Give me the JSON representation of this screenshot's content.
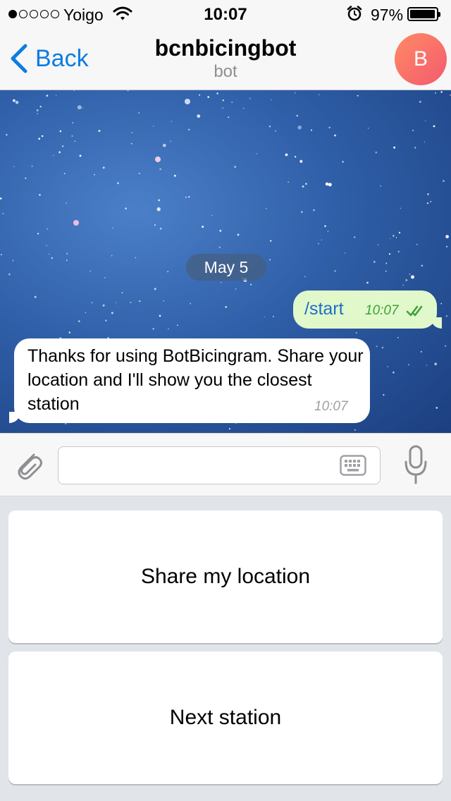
{
  "status_bar": {
    "carrier": "Yoigo",
    "time": "10:07",
    "battery": "97%",
    "battery_level": 0.97,
    "signal_bars_filled": 1,
    "signal_bars_total": 5
  },
  "nav": {
    "back_label": "Back",
    "title": "bcnbicingbot",
    "subtitle": "bot",
    "avatar_initial": "B"
  },
  "chat": {
    "date_label": "May 5",
    "messages": [
      {
        "direction": "outgoing",
        "text": "/start",
        "time": "10:07",
        "status": "read"
      },
      {
        "direction": "incoming",
        "text": "Thanks for using BotBicingram. Share your location and I'll show you the closest station",
        "time": "10:07"
      }
    ]
  },
  "input_bar": {
    "value": "",
    "placeholder": ""
  },
  "reply_keyboard": {
    "buttons": [
      {
        "label": "Share my location"
      },
      {
        "label": "Next station"
      }
    ]
  },
  "icons": {
    "signal": "signal-dots-icon",
    "wifi": "wifi-icon",
    "alarm": "alarm-icon",
    "battery": "battery-icon",
    "back": "chevron-left-icon",
    "read": "double-check-icon",
    "attach": "paperclip-icon",
    "keyboard": "keyboard-icon",
    "mic": "microphone-icon"
  },
  "colors": {
    "accent": "#0e7ddf",
    "outgoing_bubble": "#e1f8cb",
    "incoming_bubble": "#ffffff",
    "read_check": "#3ea03a",
    "avatar_gradient_start": "#ff8a65",
    "avatar_gradient_end": "#f45a6e"
  }
}
